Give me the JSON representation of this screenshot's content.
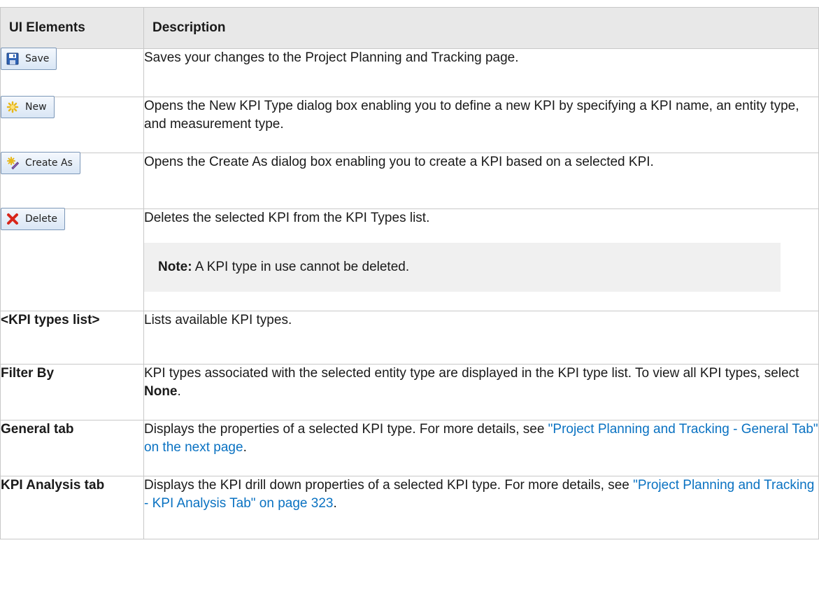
{
  "header": {
    "col1": "UI Elements",
    "col2": "Description"
  },
  "rows": {
    "save": {
      "button_label": "Save",
      "icon": "save-icon",
      "description": "Saves your changes to the Project Planning and Tracking page."
    },
    "new": {
      "button_label": "New",
      "icon": "new-icon",
      "description": "Opens the New KPI Type dialog box enabling you to define a new KPI by specifying a KPI name, an entity type, and measurement type."
    },
    "create_as": {
      "button_label": "Create As",
      "icon": "create-as-icon",
      "description": "Opens the Create As dialog box enabling you to create a KPI based on a selected KPI."
    },
    "delete": {
      "button_label": "Delete",
      "icon": "delete-icon",
      "description": "Deletes the selected KPI from the KPI Types list.",
      "note_label": "Note:",
      "note_text": " A KPI type in use cannot be deleted."
    },
    "kpi_list": {
      "label": "<KPI types list>",
      "description": "Lists available KPI types."
    },
    "filter_by": {
      "label": "Filter By",
      "description": "KPI types associated with the selected entity type are displayed in the KPI type list. To view all KPI types, select ",
      "description_bold": "None",
      "description_end": "."
    },
    "general_tab": {
      "label": "General tab",
      "description": "Displays the properties of a selected KPI type. For more details, see ",
      "link": "\"Project Planning and Tracking - General Tab\" on the next page",
      "description_end": "."
    },
    "kpi_analysis_tab": {
      "label": "KPI Analysis tab",
      "description": "Displays the KPI drill down properties of a selected KPI type. For more details, see ",
      "link": "\"Project Planning and Tracking - KPI Analysis Tab\" on page 323",
      "description_end": "."
    }
  }
}
